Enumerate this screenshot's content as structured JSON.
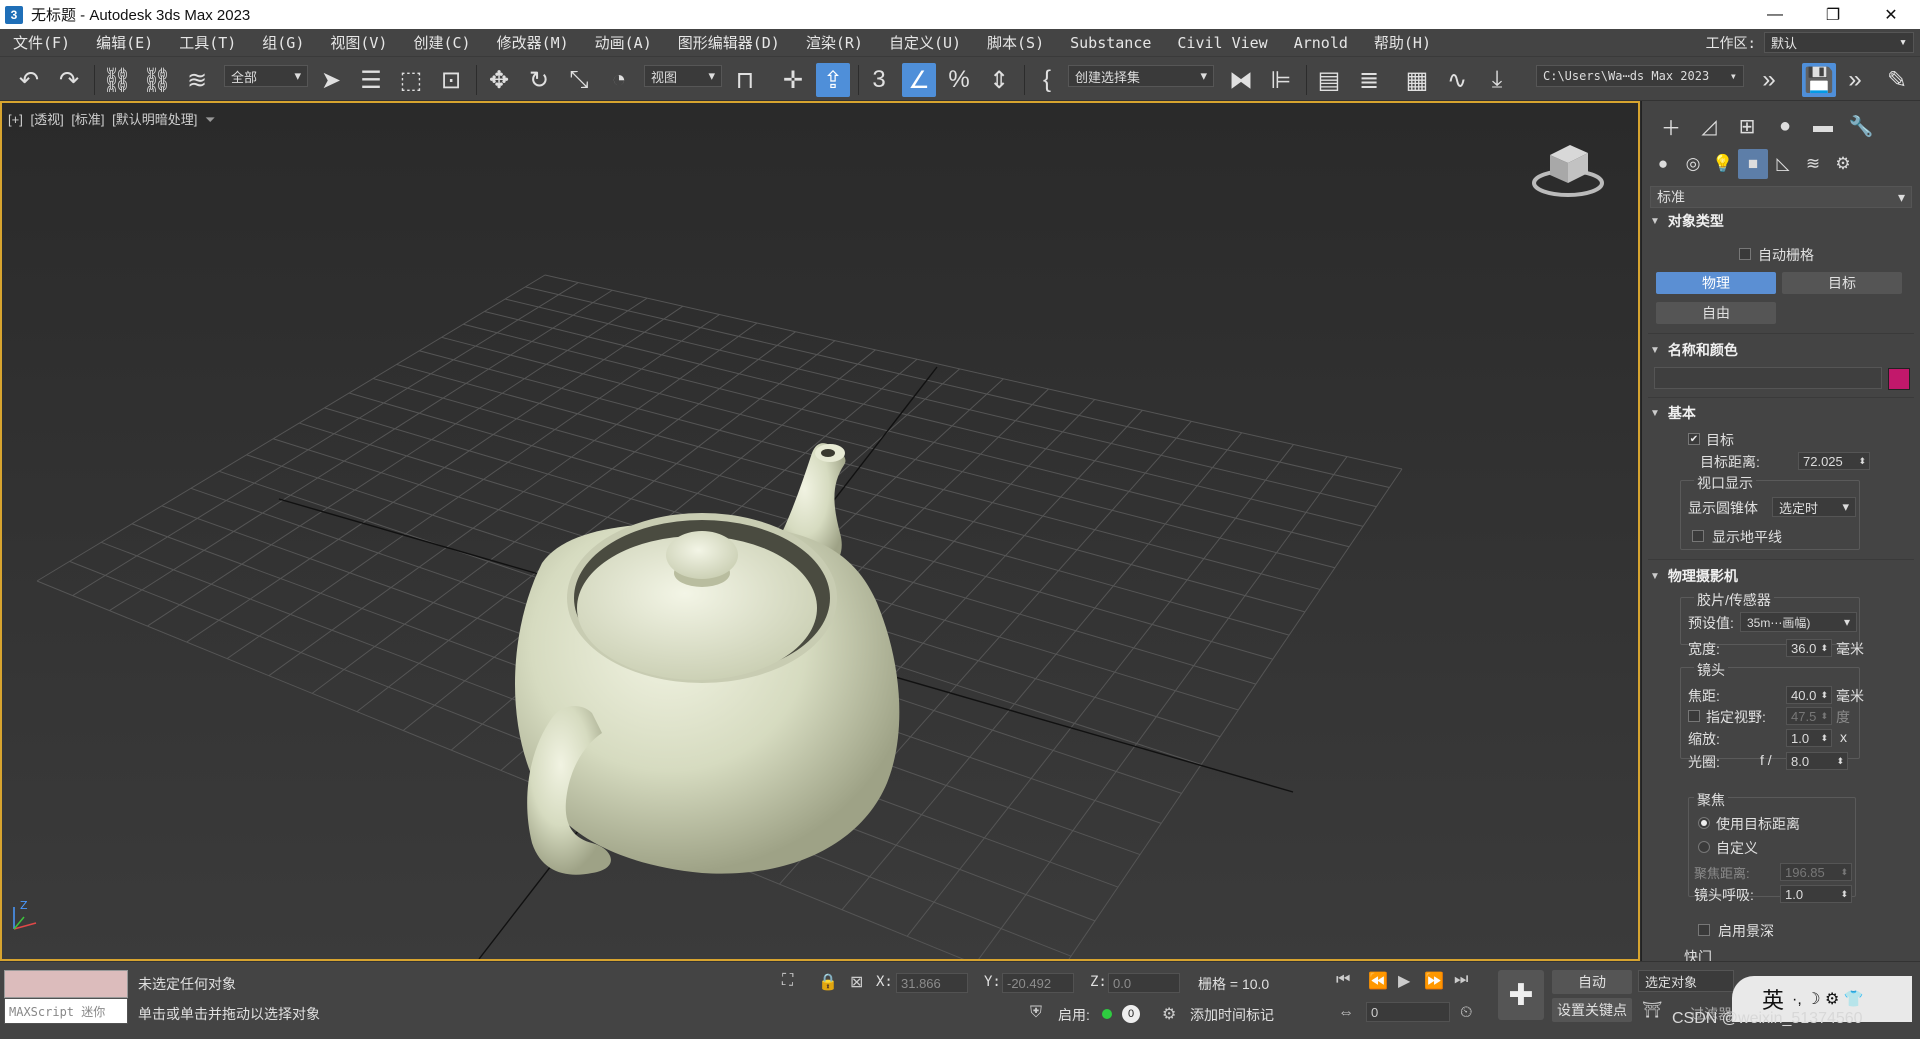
{
  "window": {
    "title": "无标题 - Autodesk 3ds Max 2023",
    "app_icon": "3",
    "minimize": "—",
    "restore": "❐",
    "close": "✕"
  },
  "menu": {
    "items": [
      "文件(F)",
      "编辑(E)",
      "工具(T)",
      "组(G)",
      "视图(V)",
      "创建(C)",
      "修改器(M)",
      "动画(A)",
      "图形编辑器(D)",
      "渲染(R)",
      "自定义(U)",
      "脚本(S)",
      "Substance",
      "Civil View",
      "Arnold",
      "帮助(H)"
    ],
    "workspace_label": "工作区:",
    "workspace_value": "默认"
  },
  "toolbar": {
    "selection_filter": "全部",
    "ref_coord": "视图",
    "named_selection": "创建选择集",
    "project_path": "C:\\Users\\Wa⋯ds Max 2023"
  },
  "viewport": {
    "labels": [
      "[+]",
      "[透视]",
      "[标准]",
      "[默认明暗处理]"
    ],
    "filter_icon": "filter-icon",
    "grid": "on"
  },
  "command_panel": {
    "category_dropdown": "标准",
    "object_type": {
      "header": "对象类型",
      "autogrid": "自动栅格",
      "buttons": [
        "物理",
        "目标",
        "自由"
      ]
    },
    "name_color": {
      "header": "名称和颜色",
      "name_value": "",
      "swatch": "#c2186b"
    },
    "basic": {
      "header": "基本",
      "target": "目标",
      "target_distance_label": "目标距离:",
      "target_distance_value": "72.025",
      "viewport_display": "视口显示",
      "show_cone_label": "显示圆锥体",
      "show_cone_value": "选定时",
      "show_horizon": "显示地平线"
    },
    "physical_camera": {
      "header": "物理摄影机",
      "film_sensor": "胶片/传感器",
      "preset_label": "预设值:",
      "preset_value": "35m⋯画幅)",
      "width_label": "宽度:",
      "width_value": "36.0",
      "width_unit": "毫米",
      "lens": "镜头",
      "focal_label": "焦距:",
      "focal_value": "40.0",
      "focal_unit": "毫米",
      "fov_label": "指定视野:",
      "fov_value": "47.5",
      "fov_unit": "度",
      "zoom_label": "缩放:",
      "zoom_value": "1.0",
      "zoom_unit": "x",
      "aperture_label": "光圈:",
      "aperture_prefix": "f /",
      "aperture_value": "8.0",
      "focus": "聚焦",
      "use_target_distance": "使用目标距离",
      "custom": "自定义",
      "focus_distance_label": "聚焦距离:",
      "focus_distance_value": "196.85",
      "lens_breathing_label": "镜头呼吸:",
      "lens_breathing_value": "1.0",
      "enable_dof": "启用景深",
      "shutter": "快门"
    }
  },
  "status": {
    "maxscript_placeholder": "MAXScript 迷你",
    "message1": "未选定任何对象",
    "message2": "单击或单击并拖动以选择对象",
    "x_label": "X:",
    "x_value": "31.866",
    "y_label": "Y:",
    "y_value": "-20.492",
    "z_label": "Z:",
    "z_value": "0.0",
    "grid_text": "栅格 = 10.0",
    "enable_label": "启用:",
    "enable_value": "0",
    "add_time_tag": "添加时间标记",
    "frame_value": "0",
    "auto_key": "自动",
    "set_key": "设置关键点",
    "selected_object": "选定对象",
    "filters": "过滤器",
    "watermark": "CSDN @weixin_51374560",
    "ime": "英"
  }
}
